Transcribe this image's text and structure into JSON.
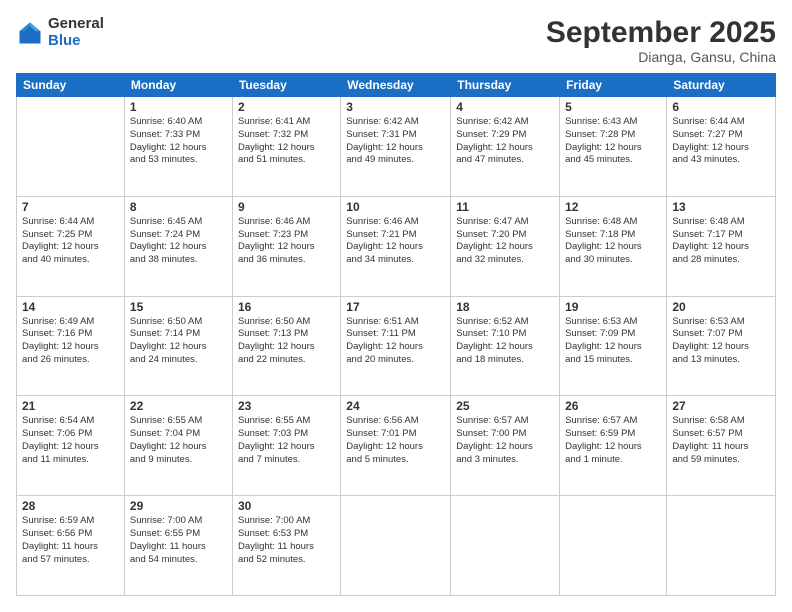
{
  "logo": {
    "general": "General",
    "blue": "Blue"
  },
  "header": {
    "month": "September 2025",
    "location": "Dianga, Gansu, China"
  },
  "weekdays": [
    "Sunday",
    "Monday",
    "Tuesday",
    "Wednesday",
    "Thursday",
    "Friday",
    "Saturday"
  ],
  "weeks": [
    [
      {
        "day": "",
        "info": ""
      },
      {
        "day": "1",
        "info": "Sunrise: 6:40 AM\nSunset: 7:33 PM\nDaylight: 12 hours\nand 53 minutes."
      },
      {
        "day": "2",
        "info": "Sunrise: 6:41 AM\nSunset: 7:32 PM\nDaylight: 12 hours\nand 51 minutes."
      },
      {
        "day": "3",
        "info": "Sunrise: 6:42 AM\nSunset: 7:31 PM\nDaylight: 12 hours\nand 49 minutes."
      },
      {
        "day": "4",
        "info": "Sunrise: 6:42 AM\nSunset: 7:29 PM\nDaylight: 12 hours\nand 47 minutes."
      },
      {
        "day": "5",
        "info": "Sunrise: 6:43 AM\nSunset: 7:28 PM\nDaylight: 12 hours\nand 45 minutes."
      },
      {
        "day": "6",
        "info": "Sunrise: 6:44 AM\nSunset: 7:27 PM\nDaylight: 12 hours\nand 43 minutes."
      }
    ],
    [
      {
        "day": "7",
        "info": "Sunrise: 6:44 AM\nSunset: 7:25 PM\nDaylight: 12 hours\nand 40 minutes."
      },
      {
        "day": "8",
        "info": "Sunrise: 6:45 AM\nSunset: 7:24 PM\nDaylight: 12 hours\nand 38 minutes."
      },
      {
        "day": "9",
        "info": "Sunrise: 6:46 AM\nSunset: 7:23 PM\nDaylight: 12 hours\nand 36 minutes."
      },
      {
        "day": "10",
        "info": "Sunrise: 6:46 AM\nSunset: 7:21 PM\nDaylight: 12 hours\nand 34 minutes."
      },
      {
        "day": "11",
        "info": "Sunrise: 6:47 AM\nSunset: 7:20 PM\nDaylight: 12 hours\nand 32 minutes."
      },
      {
        "day": "12",
        "info": "Sunrise: 6:48 AM\nSunset: 7:18 PM\nDaylight: 12 hours\nand 30 minutes."
      },
      {
        "day": "13",
        "info": "Sunrise: 6:48 AM\nSunset: 7:17 PM\nDaylight: 12 hours\nand 28 minutes."
      }
    ],
    [
      {
        "day": "14",
        "info": "Sunrise: 6:49 AM\nSunset: 7:16 PM\nDaylight: 12 hours\nand 26 minutes."
      },
      {
        "day": "15",
        "info": "Sunrise: 6:50 AM\nSunset: 7:14 PM\nDaylight: 12 hours\nand 24 minutes."
      },
      {
        "day": "16",
        "info": "Sunrise: 6:50 AM\nSunset: 7:13 PM\nDaylight: 12 hours\nand 22 minutes."
      },
      {
        "day": "17",
        "info": "Sunrise: 6:51 AM\nSunset: 7:11 PM\nDaylight: 12 hours\nand 20 minutes."
      },
      {
        "day": "18",
        "info": "Sunrise: 6:52 AM\nSunset: 7:10 PM\nDaylight: 12 hours\nand 18 minutes."
      },
      {
        "day": "19",
        "info": "Sunrise: 6:53 AM\nSunset: 7:09 PM\nDaylight: 12 hours\nand 15 minutes."
      },
      {
        "day": "20",
        "info": "Sunrise: 6:53 AM\nSunset: 7:07 PM\nDaylight: 12 hours\nand 13 minutes."
      }
    ],
    [
      {
        "day": "21",
        "info": "Sunrise: 6:54 AM\nSunset: 7:06 PM\nDaylight: 12 hours\nand 11 minutes."
      },
      {
        "day": "22",
        "info": "Sunrise: 6:55 AM\nSunset: 7:04 PM\nDaylight: 12 hours\nand 9 minutes."
      },
      {
        "day": "23",
        "info": "Sunrise: 6:55 AM\nSunset: 7:03 PM\nDaylight: 12 hours\nand 7 minutes."
      },
      {
        "day": "24",
        "info": "Sunrise: 6:56 AM\nSunset: 7:01 PM\nDaylight: 12 hours\nand 5 minutes."
      },
      {
        "day": "25",
        "info": "Sunrise: 6:57 AM\nSunset: 7:00 PM\nDaylight: 12 hours\nand 3 minutes."
      },
      {
        "day": "26",
        "info": "Sunrise: 6:57 AM\nSunset: 6:59 PM\nDaylight: 12 hours\nand 1 minute."
      },
      {
        "day": "27",
        "info": "Sunrise: 6:58 AM\nSunset: 6:57 PM\nDaylight: 11 hours\nand 59 minutes."
      }
    ],
    [
      {
        "day": "28",
        "info": "Sunrise: 6:59 AM\nSunset: 6:56 PM\nDaylight: 11 hours\nand 57 minutes."
      },
      {
        "day": "29",
        "info": "Sunrise: 7:00 AM\nSunset: 6:55 PM\nDaylight: 11 hours\nand 54 minutes."
      },
      {
        "day": "30",
        "info": "Sunrise: 7:00 AM\nSunset: 6:53 PM\nDaylight: 11 hours\nand 52 minutes."
      },
      {
        "day": "",
        "info": ""
      },
      {
        "day": "",
        "info": ""
      },
      {
        "day": "",
        "info": ""
      },
      {
        "day": "",
        "info": ""
      }
    ]
  ]
}
